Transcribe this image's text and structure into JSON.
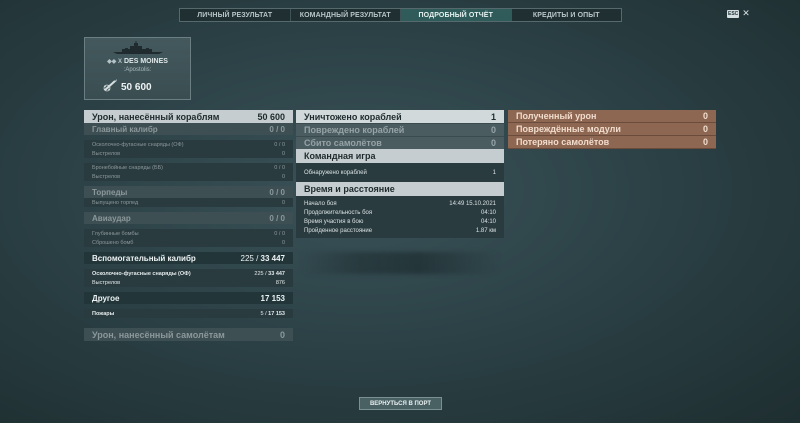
{
  "tabs": [
    {
      "label": "ЛИЧНЫЙ РЕЗУЛЬТАТ",
      "active": false
    },
    {
      "label": "КОМАНДНЫЙ РЕЗУЛЬТАТ",
      "active": false
    },
    {
      "label": "ПОДРОБНЫЙ ОТЧЁТ",
      "active": true
    },
    {
      "label": "КРЕДИТЫ И ОПЫТ",
      "active": false
    }
  ],
  "esc": {
    "key": "ESC",
    "close": "✕"
  },
  "ship": {
    "tier": "X",
    "name": "DES MOINES",
    "player": "Apostolis",
    "damage": "50 600"
  },
  "damage_panel": {
    "header": {
      "label": "Урон, нанесённый кораблям",
      "value": "50 600"
    },
    "main_battery": {
      "label": "Главный калибр",
      "value": "0 / 0",
      "he": {
        "label": "Осколочно-фугасные снаряды (ОФ)",
        "value": "0 / 0"
      },
      "he_shots": {
        "label": "Выстрелов",
        "value": "0"
      },
      "ap": {
        "label": "Бронебойные снаряды (ББ)",
        "value": "0 / 0"
      },
      "ap_shots": {
        "label": "Выстрелов",
        "value": "0"
      }
    },
    "torpedoes": {
      "label": "Торпеды",
      "value": "0 / 0",
      "launched": {
        "label": "Выпущено торпед",
        "value": "0"
      }
    },
    "airstrike": {
      "label": "Авиаудар",
      "value": "0 / 0",
      "depth_charges": {
        "label": "Глубинные бомбы",
        "value": "0 / 0"
      },
      "dropped": {
        "label": "Сброшено бомб",
        "value": "0"
      }
    },
    "secondary": {
      "label": "Вспомогательный калибр",
      "value_a": "225",
      "value_b": "33 447",
      "he": {
        "label": "Осколочно-фугасные снаряды (ОФ)",
        "value_a": "225",
        "value_b": "33 447"
      },
      "shots": {
        "label": "Выстрелов",
        "value": "876"
      }
    },
    "other": {
      "label": "Другое",
      "value": "17 153",
      "fires": {
        "label": "Пожары",
        "value_a": "5",
        "value_b": "17 153"
      }
    },
    "aircraft": {
      "label": "Урон, нанесённый самолётам",
      "value": "0"
    }
  },
  "middle_panel": {
    "destroyed": {
      "label": "Уничтожено кораблей",
      "value": "1"
    },
    "damaged": {
      "label": "Повреждено кораблей",
      "value": "0"
    },
    "planes": {
      "label": "Сбито самолётов",
      "value": "0"
    },
    "team_header": "Командная игра",
    "spotted": {
      "label": "Обнаружено кораблей",
      "value": "1"
    },
    "time_header": "Время и расстояние",
    "battle_start": {
      "label": "Начало боя",
      "value": "14:49  15.10.2021"
    },
    "duration": {
      "label": "Продолжительность боя",
      "value": "04:10"
    },
    "participation": {
      "label": "Время участия в бою",
      "value": "04:10"
    },
    "distance": {
      "label": "Пройденное расстояние",
      "value": "1.87 км"
    }
  },
  "right_panel": {
    "received": {
      "label": "Полученный урон",
      "value": "0"
    },
    "modules": {
      "label": "Повреждённые модули",
      "value": "0"
    },
    "planes_lost": {
      "label": "Потеряно самолётов",
      "value": "0"
    }
  },
  "footer": {
    "return_button": "ВЕРНУТЬСЯ В ПОРТ"
  }
}
